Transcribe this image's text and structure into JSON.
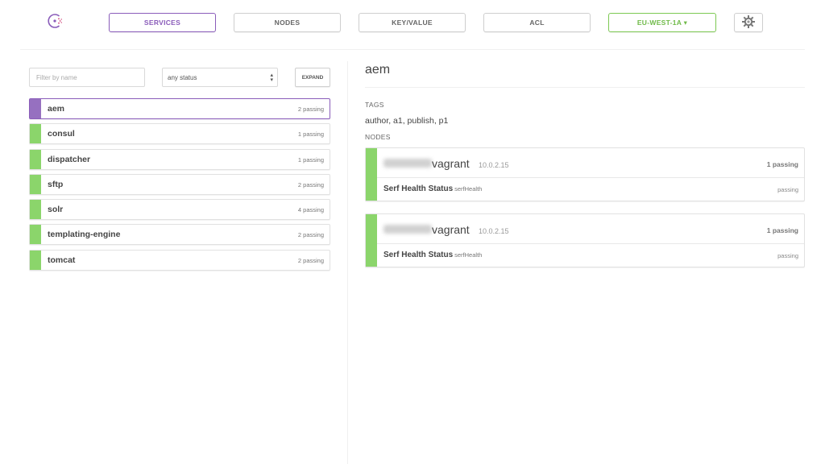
{
  "colors": {
    "accent": "#8a5cba",
    "passing": "#8bd56b",
    "datacenter": "#7dc953"
  },
  "nav": {
    "logo_icon": "consul-logo-icon",
    "items": [
      {
        "label": "SERVICES",
        "active": true
      },
      {
        "label": "NODES"
      },
      {
        "label": "KEY/VALUE"
      },
      {
        "label": "ACL"
      }
    ],
    "datacenter": "EU-WEST-1A ▾",
    "settings_icon": "gear-icon"
  },
  "filters": {
    "name_placeholder": "Filter by name",
    "status_value": "any status",
    "expand_label": "EXPAND"
  },
  "services": [
    {
      "name": "aem",
      "status": "2 passing",
      "selected": true
    },
    {
      "name": "consul",
      "status": "1 passing"
    },
    {
      "name": "dispatcher",
      "status": "1 passing"
    },
    {
      "name": "sftp",
      "status": "2 passing"
    },
    {
      "name": "solr",
      "status": "4 passing"
    },
    {
      "name": "templating-engine",
      "status": "2 passing"
    },
    {
      "name": "tomcat",
      "status": "2 passing"
    }
  ],
  "detail": {
    "title": "aem",
    "tags_label": "TAGS",
    "tags": "author, a1, publish, p1",
    "nodes_label": "NODES",
    "nodes": [
      {
        "name": "vagrant",
        "address": "10.0.2.15",
        "status": "1 passing",
        "check": {
          "name": "Serf Health Status",
          "id": "serfHealth",
          "status": "passing"
        }
      },
      {
        "name": "vagrant",
        "address": "10.0.2.15",
        "status": "1 passing",
        "check": {
          "name": "Serf Health Status",
          "id": "serfHealth",
          "status": "passing"
        }
      }
    ]
  }
}
